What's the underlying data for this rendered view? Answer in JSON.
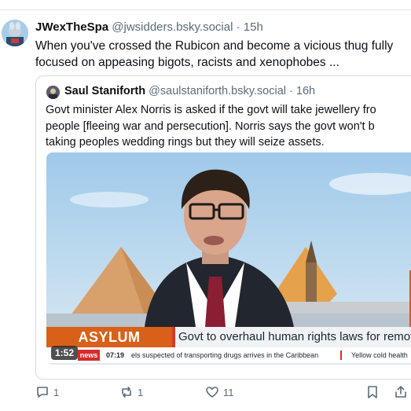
{
  "post": {
    "author_name": "JWexTheSpa",
    "handle": "@jwsidders.bsky.social",
    "separator": " · ",
    "time": "15h",
    "text": "When you've crossed the Rubicon and become a vicious thug fully focused on appeasing bigots, racists and xenophobes ..."
  },
  "quote": {
    "author_name": "Saul Staniforth",
    "handle": "@saulstaniforth.bsky.social",
    "separator": " · ",
    "time": "16h",
    "lines": [
      "Govt minister Alex Norris is asked if the govt will take jewellery fro",
      "people [fleeing war and persecution]. Norris says the govt won't b",
      "taking peoples wedding rings but they will seize assets."
    ],
    "video": {
      "ticker_label": "ASYLUM OVERHAUL",
      "ticker_headline": "Govt to overhaul human rights laws for removals",
      "news_logo": "news",
      "news_time": "07:19",
      "news_item_1": "els suspected of transporting drugs arrives in the Caribbean",
      "news_item_2": "Yellow cold health",
      "duration": "1:52"
    }
  },
  "actions": {
    "reply_count": "1",
    "repost_count": "1",
    "like_count": "11"
  },
  "colors": {
    "muted": "#5c6b7a",
    "ticker_orange": "#d96018",
    "ticker_red": "#d43a2b"
  }
}
